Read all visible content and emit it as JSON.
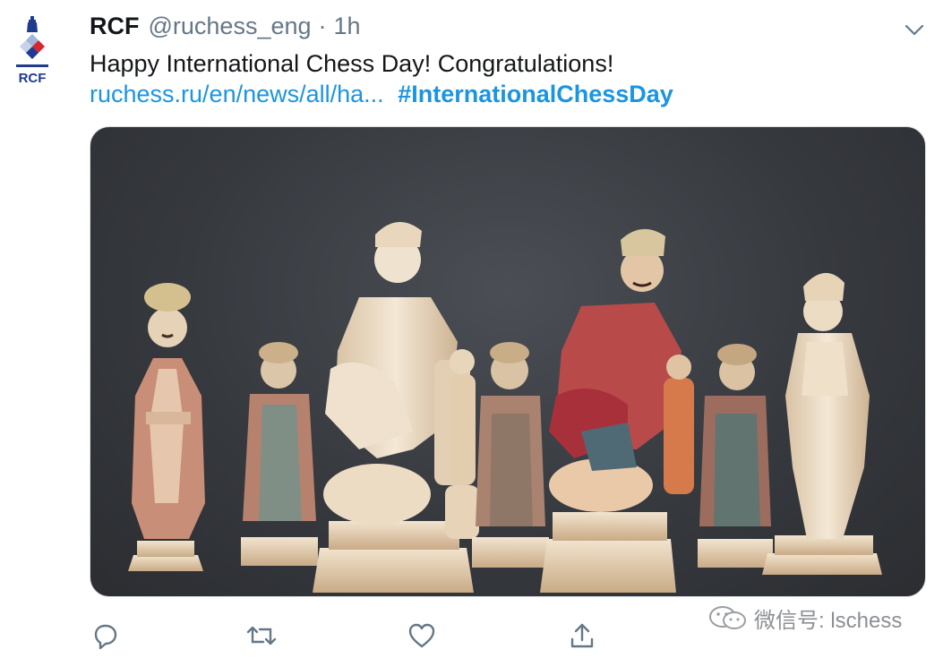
{
  "tweet": {
    "display_name": "RCF",
    "handle": "@ruchess_eng",
    "separator": "·",
    "time": "1h",
    "text": "Happy International Chess Day! Congratulations!",
    "link_text": "ruchess.ru/en/news/all/ha...",
    "hashtag": "#InternationalChessDay",
    "avatar_text": "RCF"
  },
  "actions": [
    {
      "name": "reply-icon"
    },
    {
      "name": "retweet-icon"
    },
    {
      "name": "like-icon"
    },
    {
      "name": "share-icon"
    }
  ],
  "watermark": {
    "text": "微信号: lschess"
  },
  "colors": {
    "link": "#1b95e0",
    "secondary_text": "#657786",
    "brand_blue": "#1f3b8f",
    "brand_red": "#d6262f"
  }
}
